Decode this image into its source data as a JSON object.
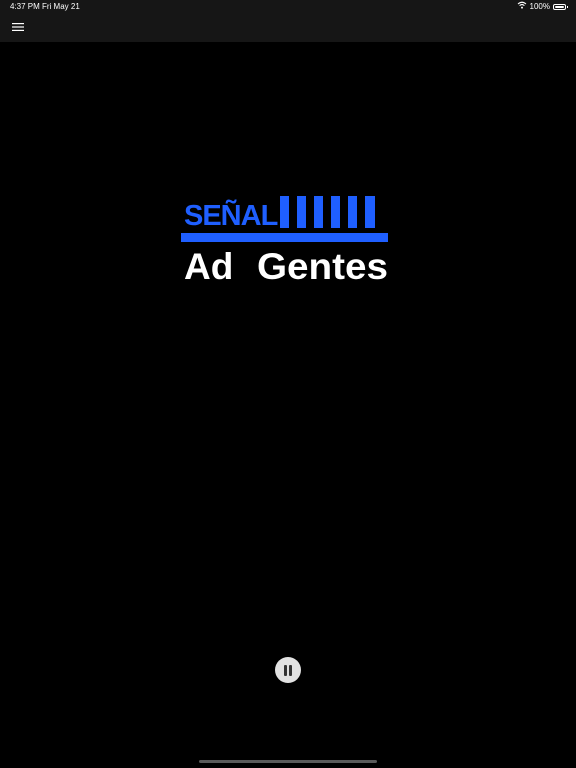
{
  "status_bar": {
    "time": "4:37 PM",
    "date": "Fri May 21",
    "battery": "100%",
    "icons": [
      "wifi-icon",
      "battery-icon"
    ]
  },
  "nav": {
    "menu_icon": "hamburger-menu-icon"
  },
  "logo": {
    "line1": "SEÑAL",
    "line2_left": "Ad",
    "line2_right": "Gentes",
    "accent_color": "#1f5fff",
    "text_color": "#ffffff"
  },
  "player": {
    "state_icon": "pause-icon"
  },
  "colors": {
    "background": "#000000",
    "bar": "#161616"
  }
}
